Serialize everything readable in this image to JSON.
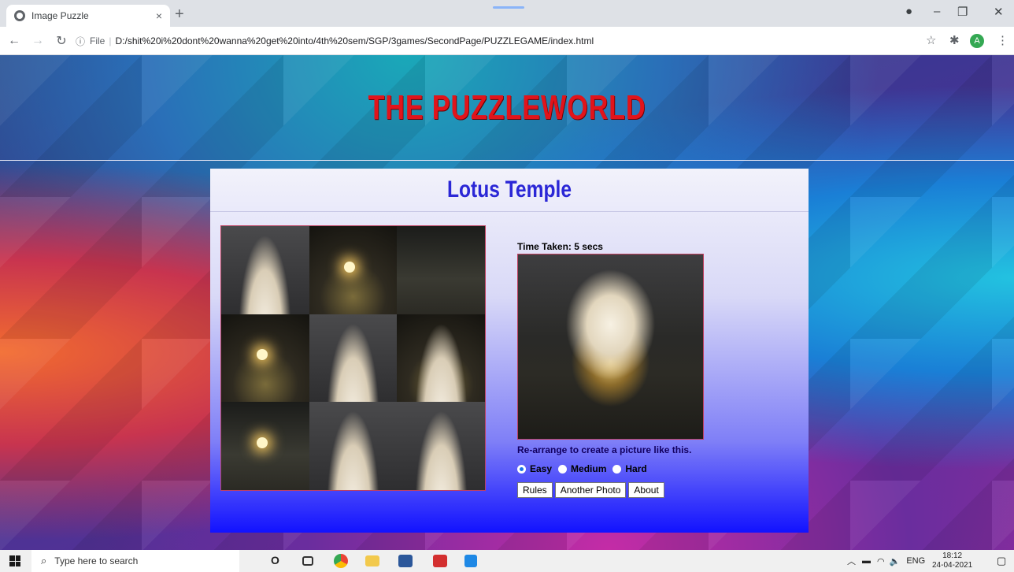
{
  "browser": {
    "tab_title": "Image Puzzle",
    "tab_close": "×",
    "new_tab": "+",
    "url_prefix": "File",
    "url": "D:/shit%20i%20dont%20wanna%20get%20into/4th%20sem/SGP/3games/SecondPage/PUZZLEGAME/index.html",
    "profile_initial": "A"
  },
  "page": {
    "site_title": "THE PUZZLEWORLD",
    "puzzle_title": "Lotus Temple",
    "time_label": "Time Taken: 5 secs",
    "hint": "Re-arrange to create a picture like this.",
    "levels": [
      {
        "label": "Easy",
        "checked": true
      },
      {
        "label": "Medium",
        "checked": false
      },
      {
        "label": "Hard",
        "checked": false
      }
    ],
    "buttons": {
      "rules": "Rules",
      "another_photo": "Another Photo",
      "about": "About"
    }
  },
  "taskbar": {
    "search_placeholder": "Type here to search",
    "language": "ENG",
    "time": "18:12",
    "date": "24-04-2021"
  }
}
